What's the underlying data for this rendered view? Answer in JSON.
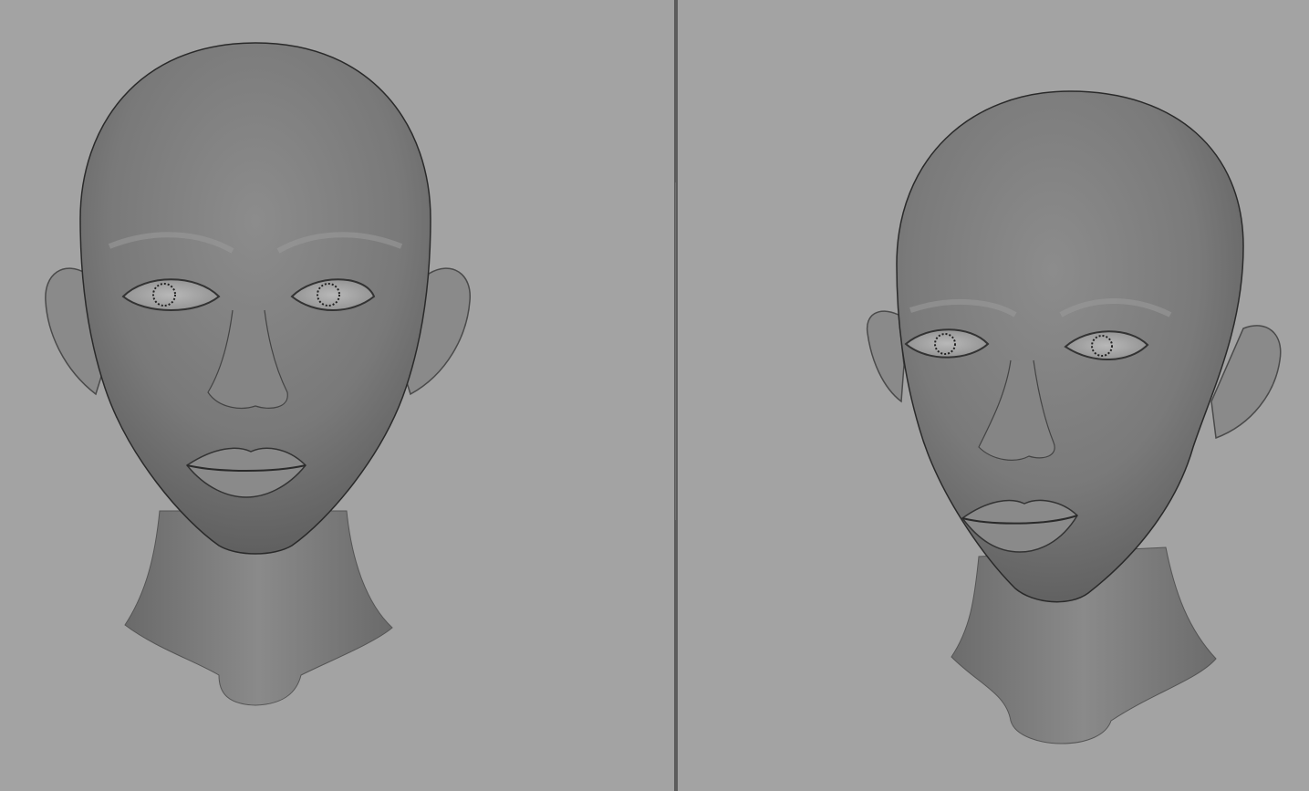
{
  "viewports": [
    {
      "id": "left",
      "view": "front",
      "model": "sculpted-head"
    },
    {
      "id": "right",
      "view": "three-quarter",
      "model": "sculpted-head"
    }
  ],
  "colors": {
    "background": "#a3a3a3",
    "splitter": "#5c5c5c",
    "skin_light": "#9a9a9a",
    "skin_mid": "#7a7a7a",
    "skin_dark": "#3a3a3a"
  }
}
